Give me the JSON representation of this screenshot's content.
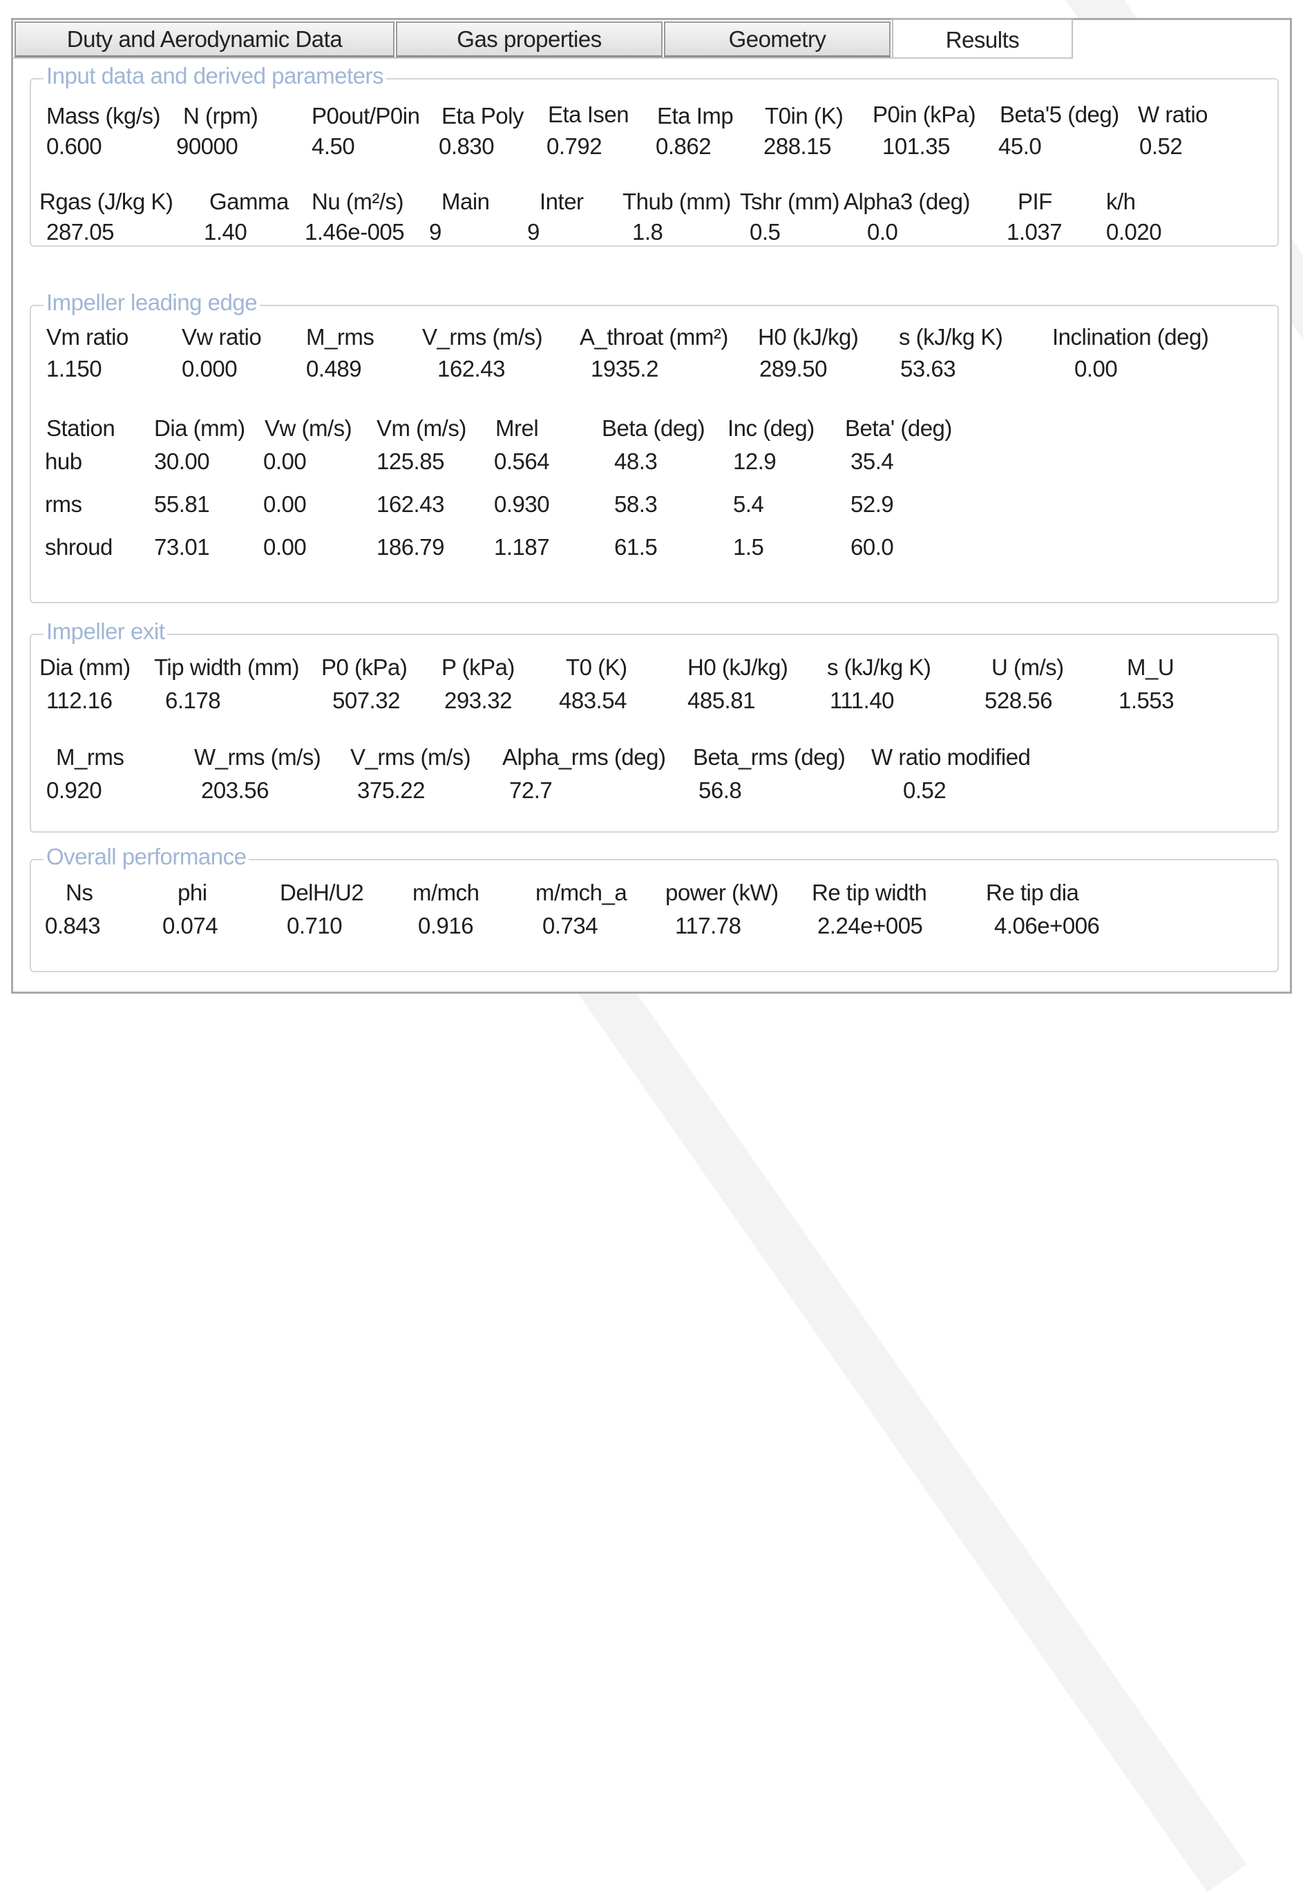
{
  "tabs": [
    "Duty and Aerodynamic Data",
    "Gas properties",
    "Geometry",
    "Results"
  ],
  "active_tab": "Results",
  "groups": {
    "input": {
      "title": "Input data and derived parameters",
      "row1": [
        {
          "label": "Mass (kg/s)",
          "value": "0.600"
        },
        {
          "label": "N (rpm)",
          "value": "90000"
        },
        {
          "label": "P0out/P0in",
          "value": "4.50"
        },
        {
          "label": "Eta Poly",
          "value": "0.830"
        },
        {
          "label": "Eta Isen",
          "value": "0.792"
        },
        {
          "label": "Eta Imp",
          "value": "0.862"
        },
        {
          "label": "T0in (K)",
          "value": "288.15"
        },
        {
          "label": "P0in (kPa)",
          "value": "101.35"
        },
        {
          "label": "Beta'5 (deg)",
          "value": "45.0"
        },
        {
          "label": "W ratio",
          "value": "0.52"
        }
      ],
      "row2": [
        {
          "label": "Rgas (J/kg K)",
          "value": "287.05"
        },
        {
          "label": "Gamma",
          "value": "1.40"
        },
        {
          "label": "Nu (m²/s)",
          "value": "1.46e-005"
        },
        {
          "label": "Main",
          "value": "9"
        },
        {
          "label": "Inter",
          "value": "9"
        },
        {
          "label": "Thub (mm)",
          "value": "1.8"
        },
        {
          "label": "Tshr (mm)",
          "value": "0.5"
        },
        {
          "label": "Alpha3 (deg)",
          "value": "0.0"
        },
        {
          "label": "PIF",
          "value": "1.037"
        },
        {
          "label": "k/h",
          "value": "0.020"
        }
      ]
    },
    "leading": {
      "title": "Impeller leading edge",
      "row1": [
        {
          "label": "Vm ratio",
          "value": "1.150"
        },
        {
          "label": "Vw ratio",
          "value": "0.000"
        },
        {
          "label": "M_rms",
          "value": "0.489"
        },
        {
          "label": "V_rms (m/s)",
          "value": "162.43"
        },
        {
          "label": "A_throat (mm²)",
          "value": "1935.2"
        },
        {
          "label": "H0 (kJ/kg)",
          "value": "289.50"
        },
        {
          "label": "s (kJ/kg K)",
          "value": "53.63"
        },
        {
          "label": "Inclination (deg)",
          "value": "0.00"
        }
      ],
      "headers": [
        "Station",
        "Dia (mm)",
        "Vw (m/s)",
        "Vm (m/s)",
        "Mrel",
        "Beta (deg)",
        "Inc (deg)",
        "Beta' (deg)"
      ],
      "rows": [
        [
          "hub",
          "30.00",
          "0.00",
          "125.85",
          "0.564",
          "48.3",
          "12.9",
          "35.4"
        ],
        [
          "rms",
          "55.81",
          "0.00",
          "162.43",
          "0.930",
          "58.3",
          "5.4",
          "52.9"
        ],
        [
          "shroud",
          "73.01",
          "0.00",
          "186.79",
          "1.187",
          "61.5",
          "1.5",
          "60.0"
        ]
      ]
    },
    "exit": {
      "title": "Impeller exit",
      "row1": [
        {
          "label": "Dia (mm)",
          "value": "112.16"
        },
        {
          "label": "Tip width (mm)",
          "value": "6.178"
        },
        {
          "label": "P0 (kPa)",
          "value": "507.32"
        },
        {
          "label": "P (kPa)",
          "value": "293.32"
        },
        {
          "label": "T0 (K)",
          "value": "483.54"
        },
        {
          "label": "H0 (kJ/kg)",
          "value": "485.81"
        },
        {
          "label": "s (kJ/kg K)",
          "value": "111.40"
        },
        {
          "label": "U (m/s)",
          "value": "528.56"
        },
        {
          "label": "M_U",
          "value": "1.553"
        }
      ],
      "row2": [
        {
          "label": "M_rms",
          "value": "0.920"
        },
        {
          "label": "W_rms (m/s)",
          "value": "203.56"
        },
        {
          "label": "V_rms (m/s)",
          "value": "375.22"
        },
        {
          "label": "Alpha_rms (deg)",
          "value": "72.7"
        },
        {
          "label": "Beta_rms (deg)",
          "value": "56.8"
        },
        {
          "label": "W ratio modified",
          "value": "0.52"
        }
      ]
    },
    "overall": {
      "title": "Overall performance",
      "row1": [
        {
          "label": "Ns",
          "value": "0.843"
        },
        {
          "label": "phi",
          "value": "0.074"
        },
        {
          "label": "DelH/U2",
          "value": "0.710"
        },
        {
          "label": "m/mch",
          "value": "0.916"
        },
        {
          "label": "m/mch_a",
          "value": "0.734"
        },
        {
          "label": "power (kW)",
          "value": "117.78"
        },
        {
          "label": "Re tip width",
          "value": "2.24e+005"
        },
        {
          "label": "Re tip dia",
          "value": "4.06e+006"
        }
      ]
    }
  }
}
